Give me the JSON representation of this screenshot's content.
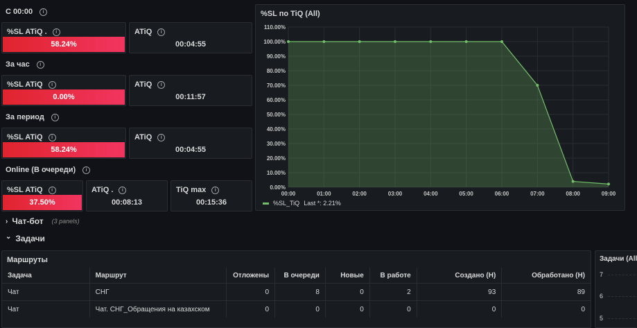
{
  "sections": {
    "s1": "С 00:00",
    "s2": "За час",
    "s3": "За период",
    "s4": "Online (В очереди)"
  },
  "stats": {
    "p1a": {
      "title": "%SL ATiQ .",
      "value": "58.24%"
    },
    "p1b": {
      "title": "ATiQ",
      "value": "00:04:55"
    },
    "p2a": {
      "title": "%SL ATiQ",
      "value": "0.00%"
    },
    "p2b": {
      "title": "ATiQ",
      "value": "00:11:57"
    },
    "p3a": {
      "title": "%SL ATiQ",
      "value": "58.24%"
    },
    "p3b": {
      "title": "ATiQ",
      "value": "00:04:55"
    },
    "p4a": {
      "title": "%SL ATiQ",
      "value": "37.50%"
    },
    "p4b": {
      "title": "ATiQ .",
      "value": "00:08:13"
    },
    "p4c": {
      "title": "TiQ max",
      "value": "00:15:36"
    }
  },
  "chart_panel": {
    "title": "%SL по TiQ (All)",
    "legend": {
      "name": "%SL_TiQ",
      "suffix": "Last *: 2.21%",
      "color": "#73bf69"
    }
  },
  "chart_data": {
    "type": "area",
    "title": "%SL по TiQ (All)",
    "x": [
      "00:00",
      "01:00",
      "02:00",
      "03:00",
      "04:00",
      "05:00",
      "06:00",
      "07:00",
      "08:00",
      "09:00"
    ],
    "y_ticks": [
      "0.00%",
      "10.00%",
      "20.00%",
      "30.00%",
      "40.00%",
      "50.00%",
      "60.00%",
      "70.00%",
      "80.00%",
      "90.00%",
      "100.00%",
      "110.00%"
    ],
    "ylim": [
      0,
      110
    ],
    "grid": true,
    "legend_position": "bottom-left",
    "series": [
      {
        "name": "%SL_TiQ",
        "color": "#73bf69",
        "values": [
          100,
          100,
          100,
          100,
          100,
          100,
          100,
          70,
          4,
          2.21
        ]
      }
    ]
  },
  "rows": {
    "chatbot": {
      "title": "Чат-бот",
      "note": "(3 panels)",
      "chevron": "›"
    },
    "tasks": {
      "title": "Задачи",
      "chevron": "⌄"
    }
  },
  "routes_table": {
    "title": "Маршруты",
    "columns": [
      "Задача",
      "Маршрут",
      "Отложены",
      "В очереди",
      "Новые",
      "В работе",
      "Создано (Н)",
      "Обработано (Н)"
    ],
    "rows": [
      [
        "Чат",
        "СНГ",
        "0",
        "8",
        "0",
        "2",
        "93",
        "89"
      ],
      [
        "Чат",
        "Чат. СНГ_Обращения на казахском",
        "0",
        "0",
        "0",
        "0",
        "0",
        "0"
      ]
    ]
  },
  "right_panel": {
    "title": "Задачи (All)",
    "ticks": [
      "7",
      "6",
      "5"
    ]
  }
}
